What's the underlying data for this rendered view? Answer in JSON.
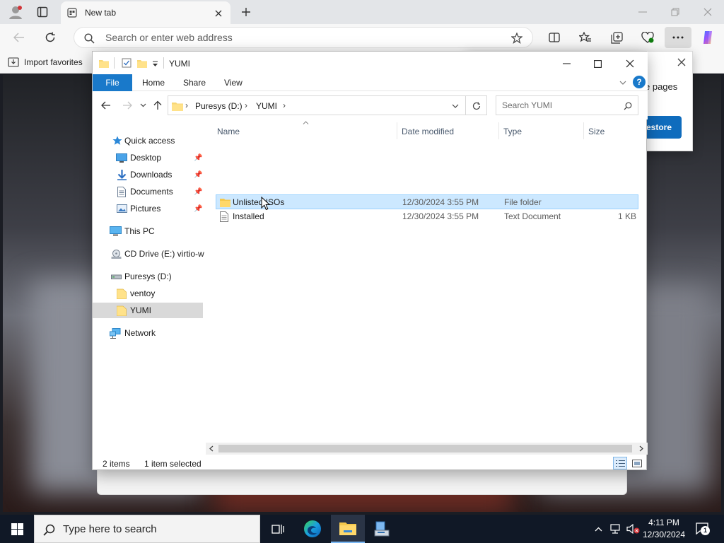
{
  "browser": {
    "tab_title": "New tab",
    "address_placeholder": "Search or enter web address",
    "favorites_import_label": "Import favorites"
  },
  "webpage": {
    "restore_partial_label": "estore",
    "pages_partial_text": "e pages"
  },
  "explorer": {
    "title": "YUMI",
    "ribbon_tabs": [
      "File",
      "Home",
      "Share",
      "View"
    ],
    "breadcrumb": [
      "Puresys (D:)",
      "YUMI"
    ],
    "search_placeholder": "Search YUMI",
    "nav_pane": {
      "quick_access": "Quick access",
      "desktop": "Desktop",
      "downloads": "Downloads",
      "documents": "Documents",
      "pictures": "Pictures",
      "this_pc": "This PC",
      "cd_drive": "CD Drive (E:) virtio-w",
      "puresys": "Puresys (D:)",
      "ventoy": "ventoy",
      "yumi": "YUMI",
      "network": "Network"
    },
    "columns": [
      "Name",
      "Date modified",
      "Type",
      "Size"
    ],
    "files": [
      {
        "name": "Unlisted ISOs",
        "date": "12/30/2024 3:55 PM",
        "type": "File folder",
        "size": ""
      },
      {
        "name": "Installed",
        "date": "12/30/2024 3:55 PM",
        "type": "Text Document",
        "size": "1 KB"
      }
    ],
    "status": {
      "count": "2 items",
      "selection": "1 item selected"
    }
  },
  "taskbar": {
    "search_placeholder": "Type here to search",
    "time": "4:11 PM",
    "date": "12/30/2024",
    "notification_count": "1"
  },
  "colors": {
    "accent": "#1979ca",
    "selection_bg": "#cce8ff",
    "selection_border": "#99d1ff",
    "taskbar": "#101826"
  },
  "icons": [
    "profile-icon",
    "tab-actions-icon",
    "new-tab-icon",
    "close-icon",
    "refresh-icon",
    "search-icon",
    "star-icon",
    "split-screen-icon",
    "favorites-icon",
    "collections-icon",
    "browser-essentials-icon",
    "more-icon",
    "copilot-icon",
    "folder-icon",
    "checkbox-icon",
    "back-arrow-icon",
    "up-arrow-icon",
    "chevron-down-icon",
    "help-icon",
    "pin-icon",
    "windows-start-icon",
    "task-view-icon",
    "edge-icon",
    "file-explorer-icon",
    "network-tray-icon",
    "volume-muted-icon",
    "notification-icon"
  ]
}
